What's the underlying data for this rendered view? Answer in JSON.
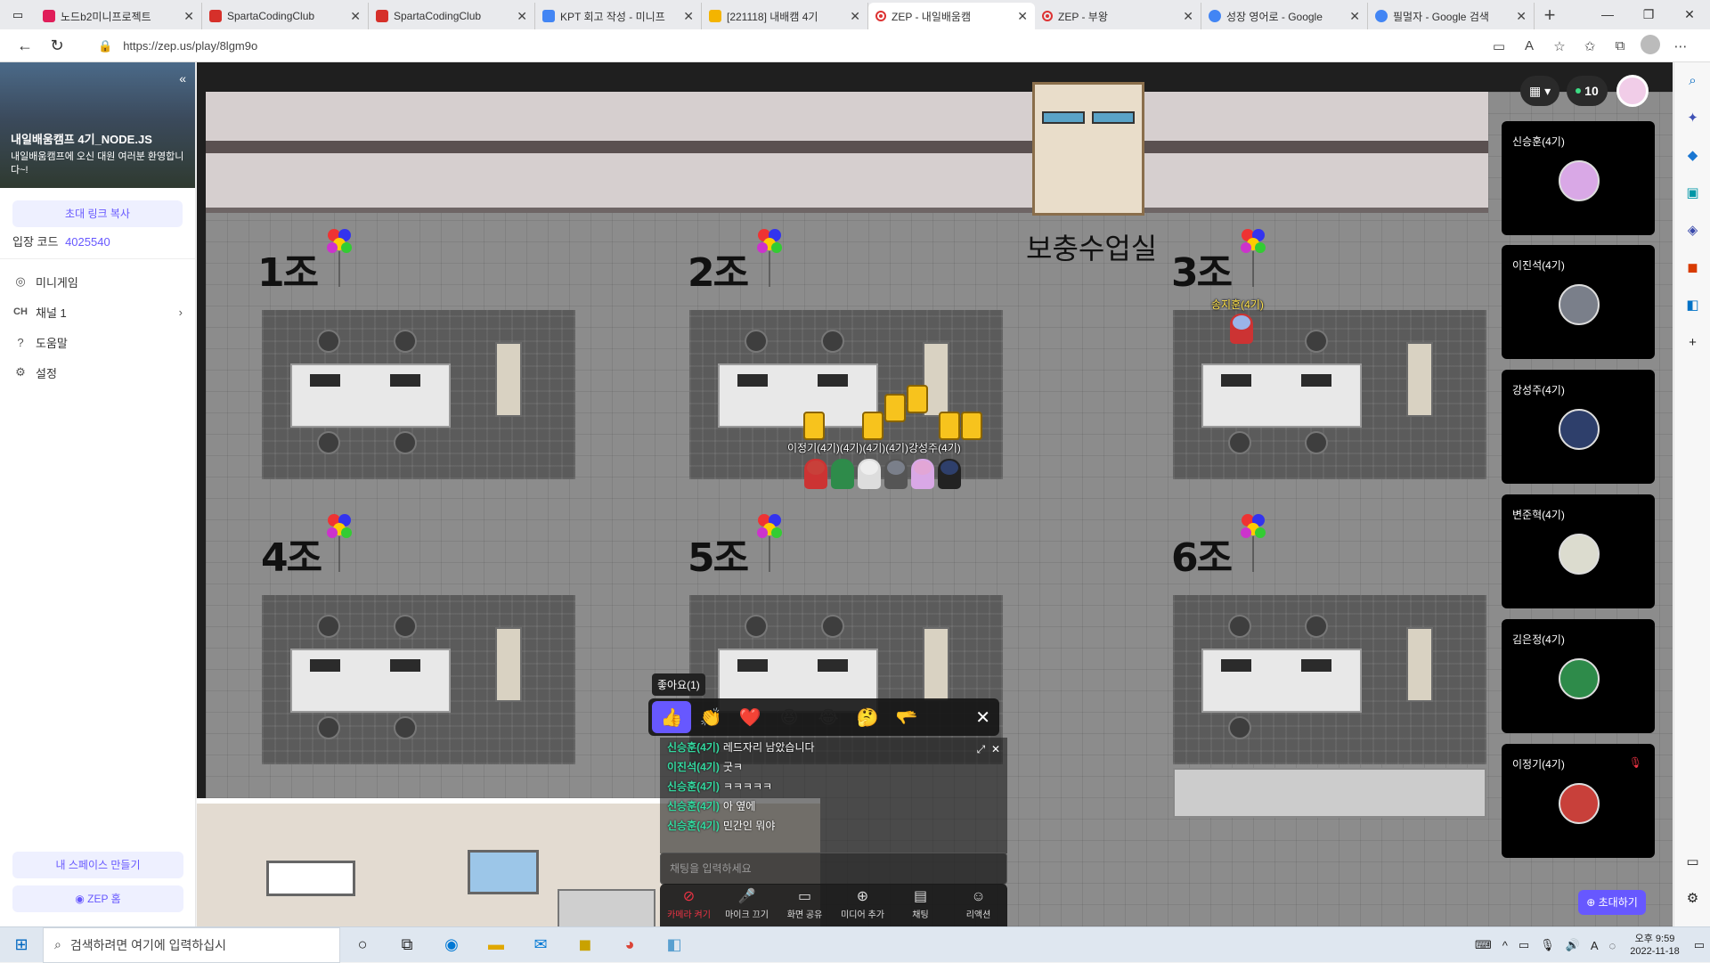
{
  "browser": {
    "tabs": [
      {
        "label": "노드b2미니프로젝트",
        "color": "#e01e5a"
      },
      {
        "label": "SpartaCodingClub",
        "color": "#d6302a"
      },
      {
        "label": "SpartaCodingClub",
        "color": "#d6302a"
      },
      {
        "label": "KPT 회고 작성 - 미니프",
        "color": "#4285f4"
      },
      {
        "label": "[221118] 내배캠 4기",
        "color": "#f4b400"
      },
      {
        "label": "ZEP - 내일배움캠",
        "color": "#6758ff",
        "active": true
      },
      {
        "label": "ZEP - 부왕",
        "color": "#6758ff"
      },
      {
        "label": "성장 영어로 - Google",
        "color": "#4285f4"
      },
      {
        "label": "필멀자 - Google 검색",
        "color": "#4285f4"
      }
    ],
    "url": "https://zep.us/play/8lgm9o"
  },
  "sidebar": {
    "space_name": "내일배움캠프 4기_NODE.JS",
    "space_desc": "내일배움캠프에 오신 대원 여러분 환영합니다~!",
    "invite_link_label": "초대 링크 복사",
    "entry_code_label": "입장 코드",
    "entry_code": "4025540",
    "menu": [
      {
        "label": "미니게임",
        "icon": "gamepad-icon"
      },
      {
        "label": "채널 1",
        "icon": "channel-icon",
        "prefix": "CH"
      },
      {
        "label": "도움말",
        "icon": "help-icon"
      },
      {
        "label": "설정",
        "icon": "settings-icon"
      }
    ],
    "create_space_label": "내 스페이스 만들기",
    "zep_home_label": "ZEP 홈"
  },
  "map": {
    "rooms": [
      "1조",
      "2조",
      "3조",
      "4조",
      "5조",
      "6조"
    ],
    "special_room": "보충수업실",
    "player_names": {
      "songjihun": "송지훈(4기)",
      "group": "이정기(4기)(4기)(4기)(4기)강성주(4기)"
    },
    "online_count": "10"
  },
  "video_tiles": [
    {
      "name": "신승훈(4기)",
      "color": "#d9a8e6"
    },
    {
      "name": "이진석(4기)",
      "color": "#7a7f8a"
    },
    {
      "name": "강성주(4기)",
      "color": "#2e3f6b"
    },
    {
      "name": "변준혁(4기)",
      "color": "#dcdccf"
    },
    {
      "name": "김은정(4기)",
      "color": "#2e8b4a"
    },
    {
      "name": "이정기(4기)",
      "color": "#c8403a",
      "muted": true
    }
  ],
  "reaction": {
    "tooltip": "좋아요(1)",
    "items": [
      "👍",
      "👏",
      "❤️",
      "😆",
      "😂",
      "🤔",
      "🫳"
    ]
  },
  "chat": {
    "messages": [
      {
        "who": "신승훈(4기)",
        "text": "레드자리 남았습니다"
      },
      {
        "who": "이진석(4기)",
        "text": "굿ㅋ"
      },
      {
        "who": "신승훈(4기)",
        "text": "ㅋㅋㅋㅋㅋ"
      },
      {
        "who": "신승훈(4기)",
        "text": "아 옆에"
      },
      {
        "who": "신승훈(4기)",
        "text": "민간인 뭐야"
      }
    ],
    "placeholder": "채팅을 입력하세요"
  },
  "toolbar": {
    "items": [
      {
        "label": "카메라 켜기",
        "icon": "camera-off-icon",
        "off": true
      },
      {
        "label": "마이크 끄기",
        "icon": "mic-icon"
      },
      {
        "label": "화면 공유",
        "icon": "screen-share-icon"
      },
      {
        "label": "미디어 추가",
        "icon": "media-add-icon"
      },
      {
        "label": "채팅",
        "icon": "chat-icon"
      },
      {
        "label": "리액션",
        "icon": "reaction-icon"
      }
    ],
    "invite_label": "초대하기"
  },
  "taskbar": {
    "search_placeholder": "검색하려면 여기에 입력하십시",
    "time": "오후 9:59",
    "date": "2022-11-18"
  }
}
